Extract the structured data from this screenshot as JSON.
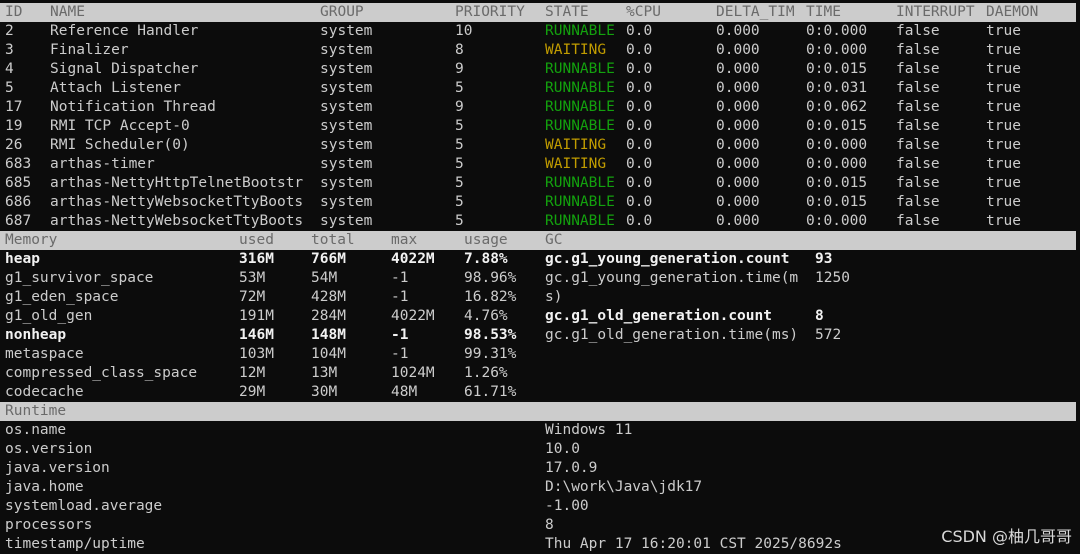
{
  "threads": {
    "headers": [
      "ID",
      "NAME",
      "GROUP",
      "PRIORITY",
      "STATE",
      "%CPU",
      "DELTA_TIM",
      "TIME",
      "INTERRUPT",
      "DAEMON"
    ],
    "rows": [
      [
        "2",
        "Reference Handler",
        "system",
        "10",
        "RUNNABLE",
        "0.0",
        "0.000",
        "0:0.000",
        "false",
        "true"
      ],
      [
        "3",
        "Finalizer",
        "system",
        "8",
        "WAITING",
        "0.0",
        "0.000",
        "0:0.000",
        "false",
        "true"
      ],
      [
        "4",
        "Signal Dispatcher",
        "system",
        "9",
        "RUNNABLE",
        "0.0",
        "0.000",
        "0:0.015",
        "false",
        "true"
      ],
      [
        "5",
        "Attach Listener",
        "system",
        "5",
        "RUNNABLE",
        "0.0",
        "0.000",
        "0:0.031",
        "false",
        "true"
      ],
      [
        "17",
        "Notification Thread",
        "system",
        "9",
        "RUNNABLE",
        "0.0",
        "0.000",
        "0:0.062",
        "false",
        "true"
      ],
      [
        "19",
        "RMI TCP Accept-0",
        "system",
        "5",
        "RUNNABLE",
        "0.0",
        "0.000",
        "0:0.015",
        "false",
        "true"
      ],
      [
        "26",
        "RMI Scheduler(0)",
        "system",
        "5",
        "WAITING",
        "0.0",
        "0.000",
        "0:0.000",
        "false",
        "true"
      ],
      [
        "683",
        "arthas-timer",
        "system",
        "5",
        "WAITING",
        "0.0",
        "0.000",
        "0:0.000",
        "false",
        "true"
      ],
      [
        "685",
        "arthas-NettyHttpTelnetBootstr",
        "system",
        "5",
        "RUNNABLE",
        "0.0",
        "0.000",
        "0:0.015",
        "false",
        "true"
      ],
      [
        "686",
        "arthas-NettyWebsocketTtyBoots",
        "system",
        "5",
        "RUNNABLE",
        "0.0",
        "0.000",
        "0:0.015",
        "false",
        "true"
      ],
      [
        "687",
        "arthas-NettyWebsocketTtyBoots",
        "system",
        "5",
        "RUNNABLE",
        "0.0",
        "0.000",
        "0:0.000",
        "false",
        "true"
      ]
    ]
  },
  "memory": {
    "headers": [
      "Memory",
      "used",
      "total",
      "max",
      "usage",
      "GC"
    ],
    "rows": [
      [
        "heap",
        "316M",
        "766M",
        "4022M",
        "7.88%"
      ],
      [
        "g1_survivor_space",
        "53M",
        "54M",
        "-1",
        "98.96%"
      ],
      [
        "g1_eden_space",
        "72M",
        "428M",
        "-1",
        "16.82%"
      ],
      [
        "g1_old_gen",
        "191M",
        "284M",
        "4022M",
        "4.76%"
      ],
      [
        "nonheap",
        "146M",
        "148M",
        "-1",
        "98.53%"
      ],
      [
        "metaspace",
        "103M",
        "104M",
        "-1",
        "99.31%"
      ],
      [
        "compressed_class_space",
        "12M",
        "13M",
        "1024M",
        "1.26%"
      ],
      [
        "codecache",
        "29M",
        "30M",
        "48M",
        "61.71%"
      ]
    ],
    "gc": [
      [
        "gc.g1_young_generation.count",
        "93"
      ],
      [
        "gc.g1_young_generation.time(m",
        "1250"
      ],
      [
        "s)",
        ""
      ],
      [
        "gc.g1_old_generation.count",
        "8"
      ],
      [
        "gc.g1_old_generation.time(ms)",
        "572"
      ]
    ]
  },
  "runtime": {
    "header": "Runtime",
    "rows": [
      [
        "os.name",
        "Windows 11"
      ],
      [
        "os.version",
        "10.0"
      ],
      [
        "java.version",
        "17.0.9"
      ],
      [
        "java.home",
        "D:\\work\\Java\\jdk17"
      ],
      [
        "systemload.average",
        "-1.00"
      ],
      [
        "processors",
        "8"
      ],
      [
        "timestamp/uptime",
        "Thu Apr 17 16:20:01 CST 2025/8692s"
      ]
    ]
  },
  "watermark": "CSDN @柚几哥哥"
}
